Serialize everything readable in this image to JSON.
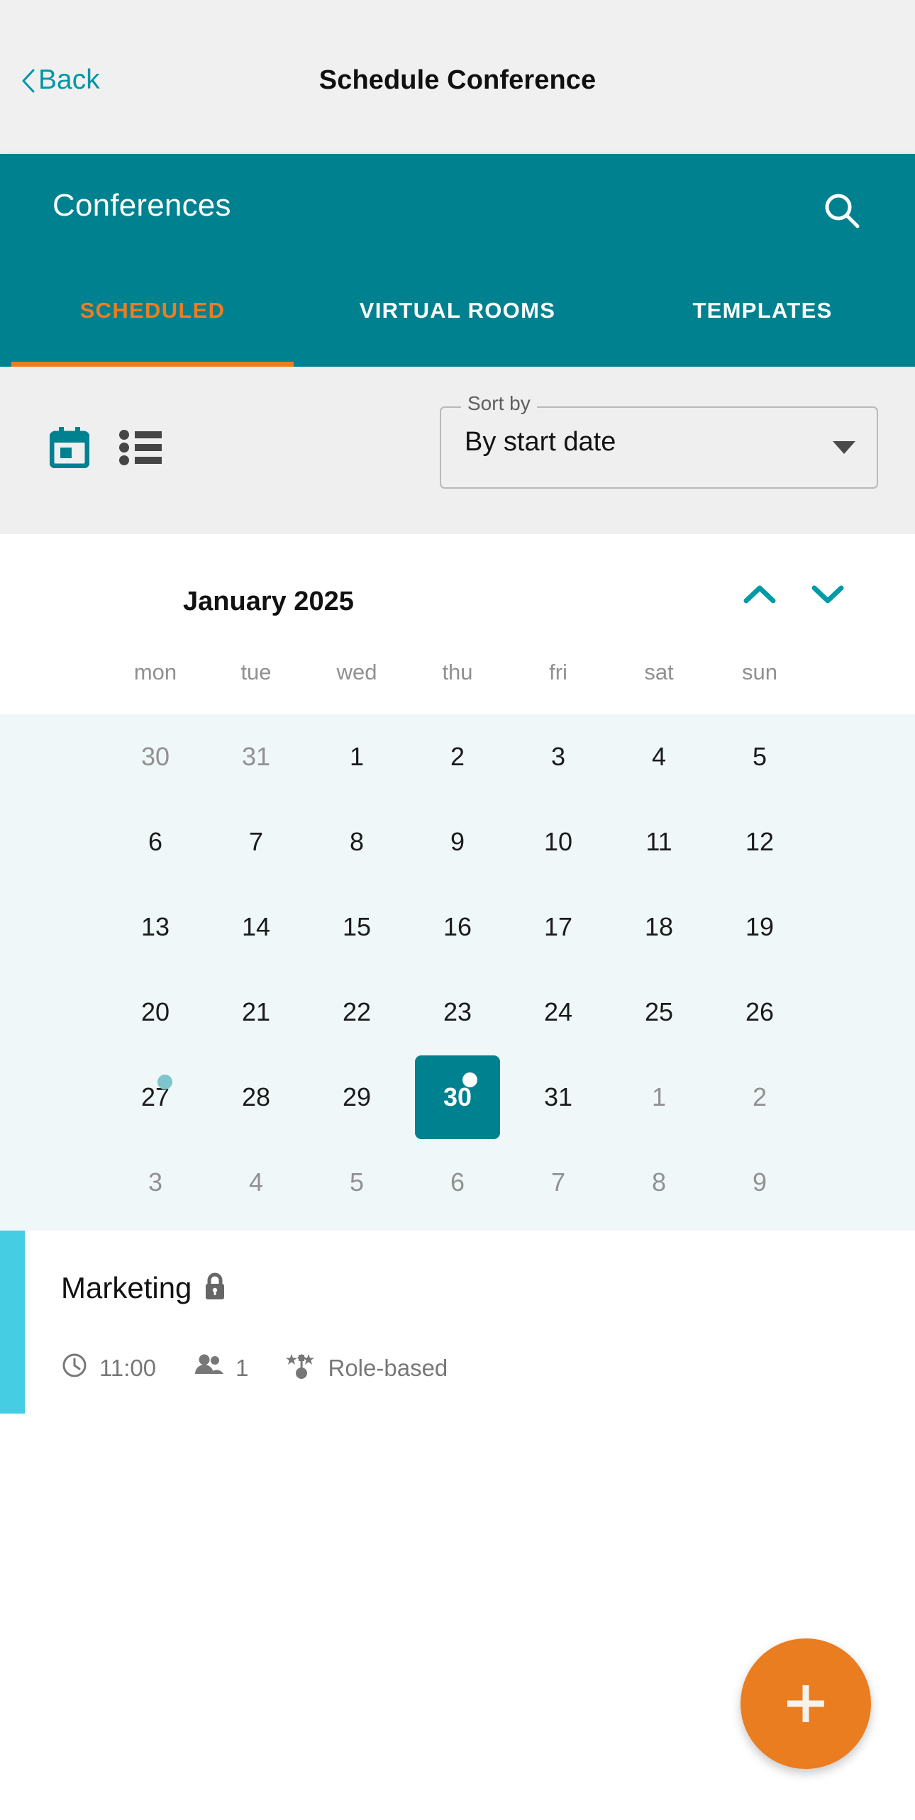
{
  "navbar": {
    "back_label": "Back",
    "title": "Schedule Conference",
    "back_icon": "chevron-left-icon"
  },
  "appbar": {
    "title": "Conferences",
    "search_icon": "search-icon",
    "accent_color": "#008190",
    "tabs": [
      {
        "label": "SCHEDULED",
        "active": true
      },
      {
        "label": "VIRTUAL ROOMS",
        "active": false
      },
      {
        "label": "TEMPLATES",
        "active": false
      }
    ],
    "active_tab_color": "#f07c20"
  },
  "toolbar": {
    "calendar_view_icon": "calendar-view-icon",
    "list_view_icon": "list-view-icon",
    "sort": {
      "legend": "Sort by",
      "value": "By start date",
      "caret_icon": "chevron-down-icon"
    }
  },
  "calendar": {
    "month_label": "January 2025",
    "prev_icon": "chevron-up-icon",
    "next_icon": "chevron-down-icon",
    "day_headers": [
      "mon",
      "tue",
      "wed",
      "thu",
      "fri",
      "sat",
      "sun"
    ],
    "weeks": [
      [
        {
          "num": "30",
          "muted": true
        },
        {
          "num": "31",
          "muted": true
        },
        {
          "num": "1",
          "muted": false
        },
        {
          "num": "2",
          "muted": false
        },
        {
          "num": "3",
          "muted": false
        },
        {
          "num": "4",
          "muted": false
        },
        {
          "num": "5",
          "muted": false
        }
      ],
      [
        {
          "num": "6",
          "muted": false
        },
        {
          "num": "7",
          "muted": false
        },
        {
          "num": "8",
          "muted": false
        },
        {
          "num": "9",
          "muted": false
        },
        {
          "num": "10",
          "muted": false
        },
        {
          "num": "11",
          "muted": false
        },
        {
          "num": "12",
          "muted": false
        }
      ],
      [
        {
          "num": "13",
          "muted": false
        },
        {
          "num": "14",
          "muted": false
        },
        {
          "num": "15",
          "muted": false
        },
        {
          "num": "16",
          "muted": false
        },
        {
          "num": "17",
          "muted": false
        },
        {
          "num": "18",
          "muted": false
        },
        {
          "num": "19",
          "muted": false
        }
      ],
      [
        {
          "num": "20",
          "muted": false
        },
        {
          "num": "21",
          "muted": false
        },
        {
          "num": "22",
          "muted": false
        },
        {
          "num": "23",
          "muted": false
        },
        {
          "num": "24",
          "muted": false
        },
        {
          "num": "25",
          "muted": false
        },
        {
          "num": "26",
          "muted": false
        }
      ],
      [
        {
          "num": "27",
          "muted": false,
          "dot": "teal"
        },
        {
          "num": "28",
          "muted": false
        },
        {
          "num": "29",
          "muted": false
        },
        {
          "num": "30",
          "muted": false,
          "selected": true,
          "dot": "white"
        },
        {
          "num": "31",
          "muted": false
        },
        {
          "num": "1",
          "muted": true
        },
        {
          "num": "2",
          "muted": true
        }
      ],
      [
        {
          "num": "3",
          "muted": true
        },
        {
          "num": "4",
          "muted": true
        },
        {
          "num": "5",
          "muted": true
        },
        {
          "num": "6",
          "muted": true
        },
        {
          "num": "7",
          "muted": true
        },
        {
          "num": "8",
          "muted": true
        },
        {
          "num": "9",
          "muted": true
        }
      ]
    ],
    "selected_color": "#008190",
    "body_background": "#eff7f9"
  },
  "events": [
    {
      "title": "Marketing",
      "lock_icon": "lock-icon",
      "accent_color": "#45cde4",
      "time": "11:00",
      "time_icon": "clock-icon",
      "participants": "1",
      "participants_icon": "people-icon",
      "access": "Role-based",
      "access_icon": "role-based-icon"
    }
  ],
  "fab": {
    "label": "+",
    "icon": "plus-icon",
    "color": "#e97d1f"
  }
}
